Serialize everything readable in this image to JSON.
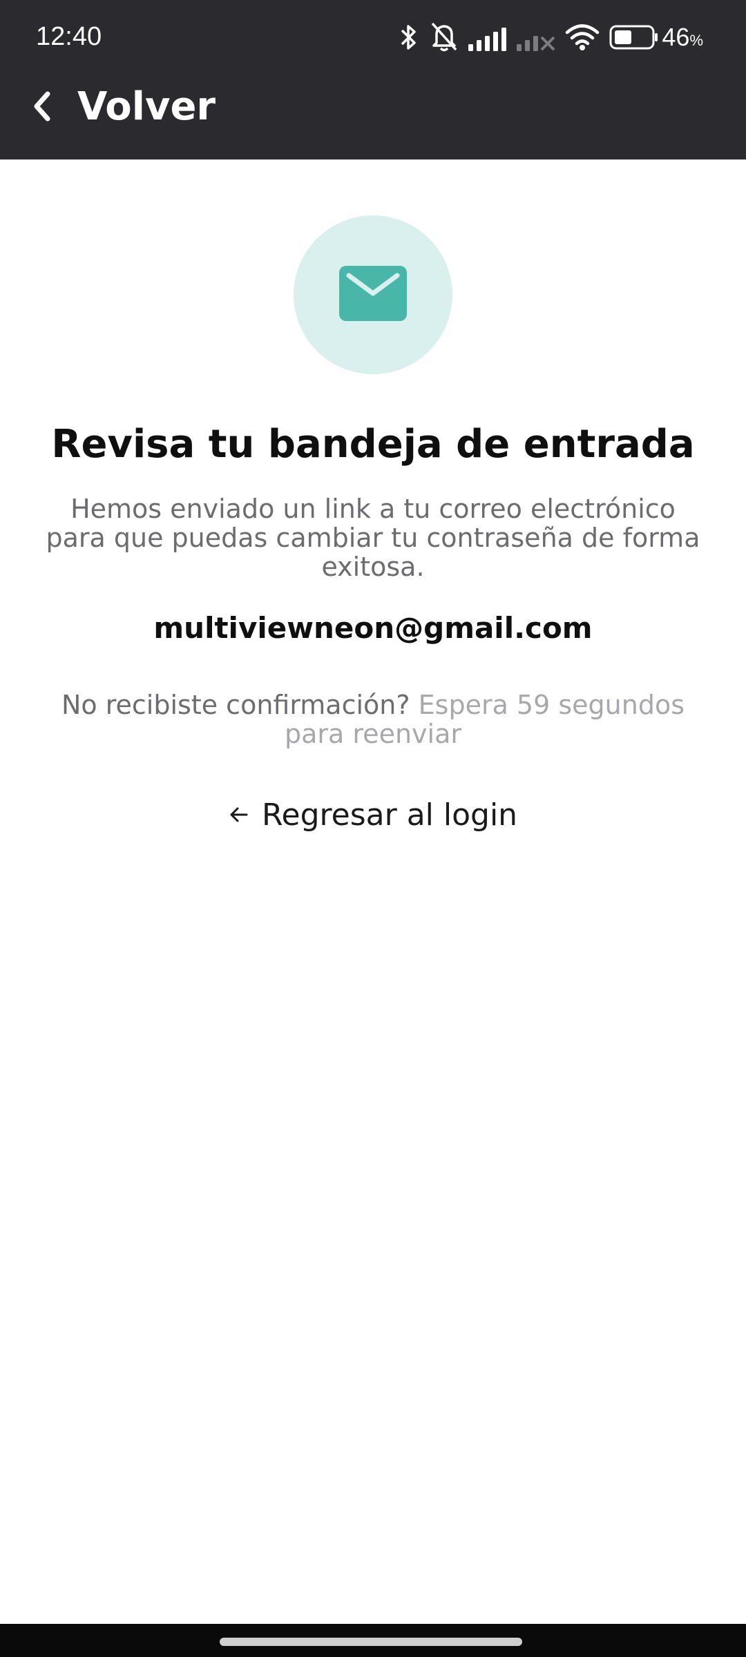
{
  "status_bar": {
    "time": "12:40",
    "battery_percent": "46",
    "battery_unit": "%",
    "icons": [
      "bluetooth-icon",
      "bell-off-icon",
      "signal-icon",
      "signal-no-service-icon",
      "wifi-icon",
      "battery-icon"
    ]
  },
  "app_bar": {
    "back_label": "Volver",
    "back_icon": "chevron-left-icon"
  },
  "main": {
    "icon": "mail-icon",
    "title": "Revisa tu bandeja de entrada",
    "description": "Hemos enviado un link a tu correo electrónico para que puedas cambiar tu contraseña de forma exitosa.",
    "email": "multiviewneon@gmail.com",
    "resend_question": "No recibiste confirmación?",
    "resend_wait": "Espera 59 segundos para reenviar",
    "login_link_label": "Regresar al login",
    "login_link_icon": "arrow-left-icon"
  },
  "colors": {
    "header_bg": "#2b2a2f",
    "accent": "#48b7aa",
    "accent_light": "#daf0ee",
    "text_primary": "#0f0f10",
    "text_secondary": "#6c6c70",
    "text_muted": "#a8a8ac"
  }
}
